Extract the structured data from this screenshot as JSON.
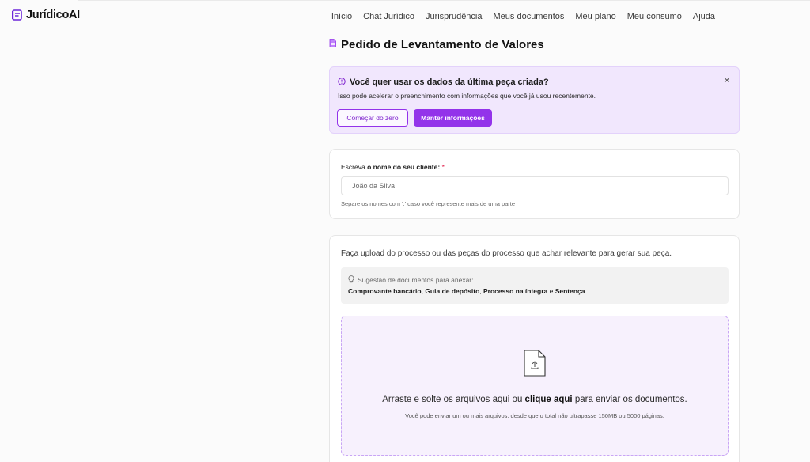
{
  "app": {
    "name": "JurídicoAI",
    "accent": "#9333ea"
  },
  "nav": {
    "items": [
      "Início",
      "Chat Jurídico",
      "Jurisprudência",
      "Meus documentos",
      "Meu plano",
      "Meu consumo",
      "Ajuda"
    ]
  },
  "page": {
    "title": "Pedido de Levantamento de Valores",
    "title_icon": "document-icon"
  },
  "notice": {
    "title": "Você quer usar os dados da última peça criada?",
    "text": "Isso pode acelerar o preenchimento com informações que você já usou recentemente.",
    "start_label": "Começar do zero",
    "keep_label": "Manter informações",
    "close_icon": "close-icon",
    "info_icon": "info-icon"
  },
  "client": {
    "label_prefix": "Escreva ",
    "label_bold": "o nome do seu cliente:",
    "required_mark": "*",
    "placeholder": "João da Silva",
    "value": "",
    "hint": "Separe os nomes com ';' caso você represente mais de uma parte"
  },
  "upload": {
    "intro": "Faça upload do processo ou das peças do processo que achar relevante para gerar sua peça.",
    "suggest_title": "Sugestão de documentos para anexar:",
    "suggest_icon": "lightbulb-icon",
    "docs": [
      "Comprovante bancário",
      "Guia de depósito",
      "Processo na íntegra",
      "Sentença"
    ],
    "sep_comma": ", ",
    "sep_and": " e ",
    "end": ".",
    "drop_before": "Arraste e solte os arquivos aqui ou ",
    "drop_link": "clique aqui",
    "drop_after": " para enviar os documentos.",
    "drop_sub": "Você pode enviar um ou mais arquivos, desde que o total não ultrapasse 150MB ou 5000 páginas.",
    "file_icon": "file-upload-icon"
  }
}
